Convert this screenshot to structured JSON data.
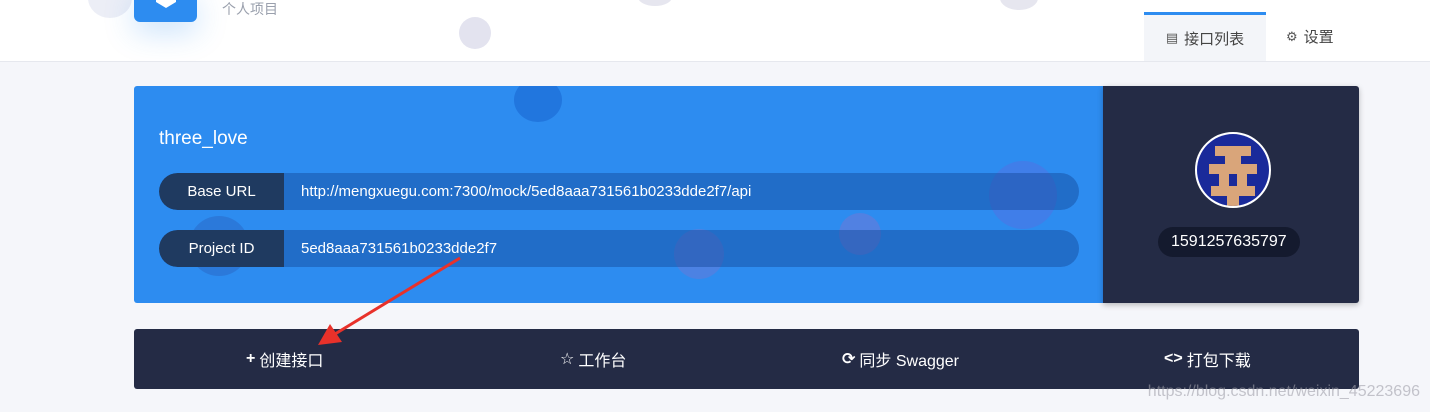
{
  "header": {
    "project_type": "个人项目",
    "tabs": [
      {
        "label": "接口列表",
        "icon": "list-icon",
        "active": true
      },
      {
        "label": "设置",
        "icon": "gear-icon",
        "active": false
      }
    ]
  },
  "project": {
    "name": "three_love",
    "base_url_label": "Base URL",
    "base_url": "http://mengxuegu.com:7300/mock/5ed8aaa731561b0233dde2f7/api",
    "project_id_label": "Project ID",
    "project_id": "5ed8aaa731561b0233dde2f7"
  },
  "user": {
    "id": "1591257635797",
    "avatar_icon": "pixel-avatar-icon"
  },
  "actions": [
    {
      "label": "创建接口",
      "icon": "plus-icon"
    },
    {
      "label": "工作台",
      "icon": "star-icon"
    },
    {
      "label": "同步 Swagger",
      "icon": "sync-icon"
    },
    {
      "label": "打包下载",
      "icon": "code-icon"
    }
  ],
  "watermark": "https://blog.csdn.net/weixin_45223696",
  "colors": {
    "accent": "#2d8cf0",
    "dark": "#242b45",
    "arrow": "#e8312a"
  }
}
